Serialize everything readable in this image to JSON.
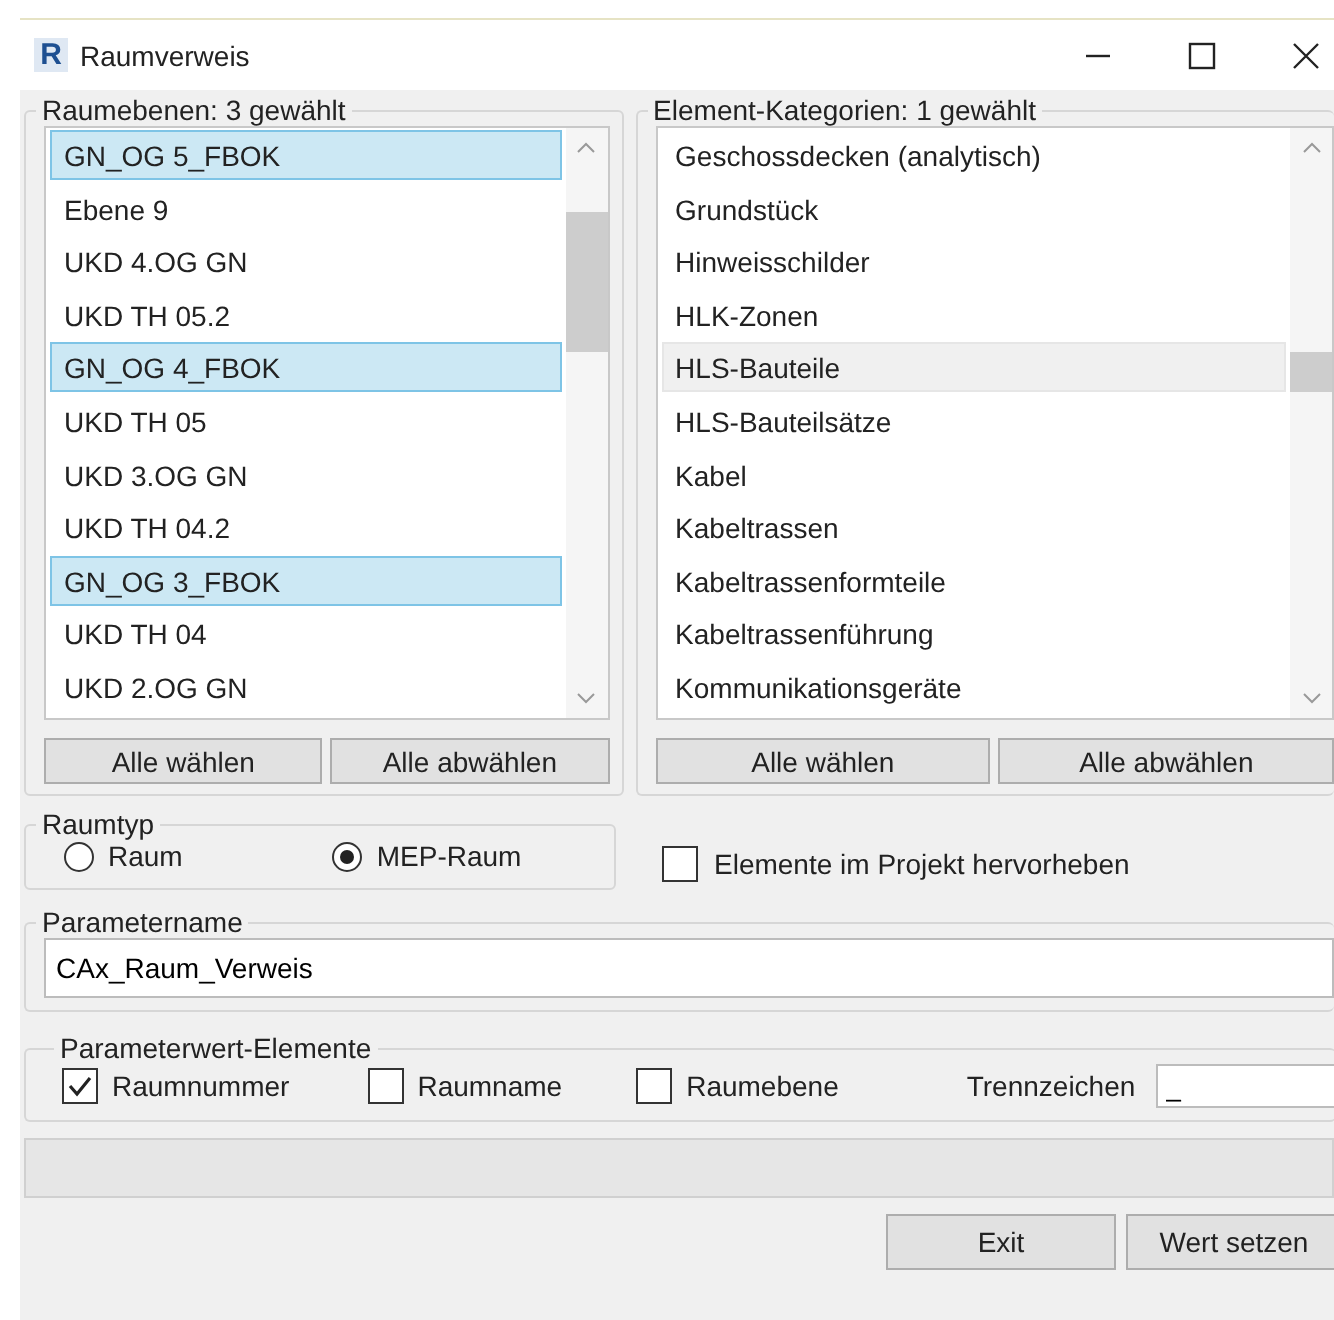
{
  "window": {
    "title": "Raumverweis",
    "app_icon_letter": "R"
  },
  "raumebenen": {
    "title": "Raumebenen: 3 gewählt",
    "items": [
      {
        "label": "GN_OG 5_FBOK",
        "selected": true
      },
      {
        "label": "Ebene 9",
        "selected": false
      },
      {
        "label": "UKD 4.OG GN",
        "selected": false
      },
      {
        "label": "UKD TH 05.2",
        "selected": false
      },
      {
        "label": "GN_OG 4_FBOK",
        "selected": true
      },
      {
        "label": "UKD TH 05",
        "selected": false
      },
      {
        "label": "UKD 3.OG GN",
        "selected": false
      },
      {
        "label": "UKD TH 04.2",
        "selected": false
      },
      {
        "label": "GN_OG 3_FBOK",
        "selected": true
      },
      {
        "label": "UKD TH 04",
        "selected": false
      },
      {
        "label": "UKD 2.OG GN",
        "selected": false
      }
    ],
    "buttons": [
      "Alle wählen",
      "Alle abwählen"
    ]
  },
  "kategorien": {
    "title": "Element-Kategorien: 1 gewählt",
    "items": [
      {
        "label": "Geschossdecken (analytisch)",
        "selected": false
      },
      {
        "label": "Grundstück",
        "selected": false
      },
      {
        "label": "Hinweisschilder",
        "selected": false
      },
      {
        "label": "HLK-Zonen",
        "selected": false
      },
      {
        "label": "HLS-Bauteile",
        "selected": true
      },
      {
        "label": "HLS-Bauteilsätze",
        "selected": false
      },
      {
        "label": "Kabel",
        "selected": false
      },
      {
        "label": "Kabeltrassen",
        "selected": false
      },
      {
        "label": "Kabeltrassenformteile",
        "selected": false
      },
      {
        "label": "Kabeltrassenführung",
        "selected": false
      },
      {
        "label": "Kommunikationsgeräte",
        "selected": false
      }
    ],
    "buttons": [
      "Alle wählen",
      "Alle abwählen"
    ]
  },
  "raumtyp": {
    "title": "Raumtyp",
    "options": [
      {
        "label": "Raum",
        "selected": false
      },
      {
        "label": "MEP-Raum",
        "selected": true
      }
    ]
  },
  "hervorheben": {
    "label": "Elemente im Projekt hervorheben",
    "checked": false
  },
  "parametername": {
    "title": "Parametername",
    "value": "CAx_Raum_Verweis"
  },
  "parameterwert": {
    "title": "Parameterwert-Elemente",
    "options": [
      {
        "label": "Raumnummer",
        "checked": true
      },
      {
        "label": "Raumname",
        "checked": false
      },
      {
        "label": "Raumebene",
        "checked": false
      }
    ],
    "separator_label": "Trennzeichen",
    "separator_value": "_"
  },
  "buttons": [
    "Exit",
    "Wert setzen"
  ]
}
